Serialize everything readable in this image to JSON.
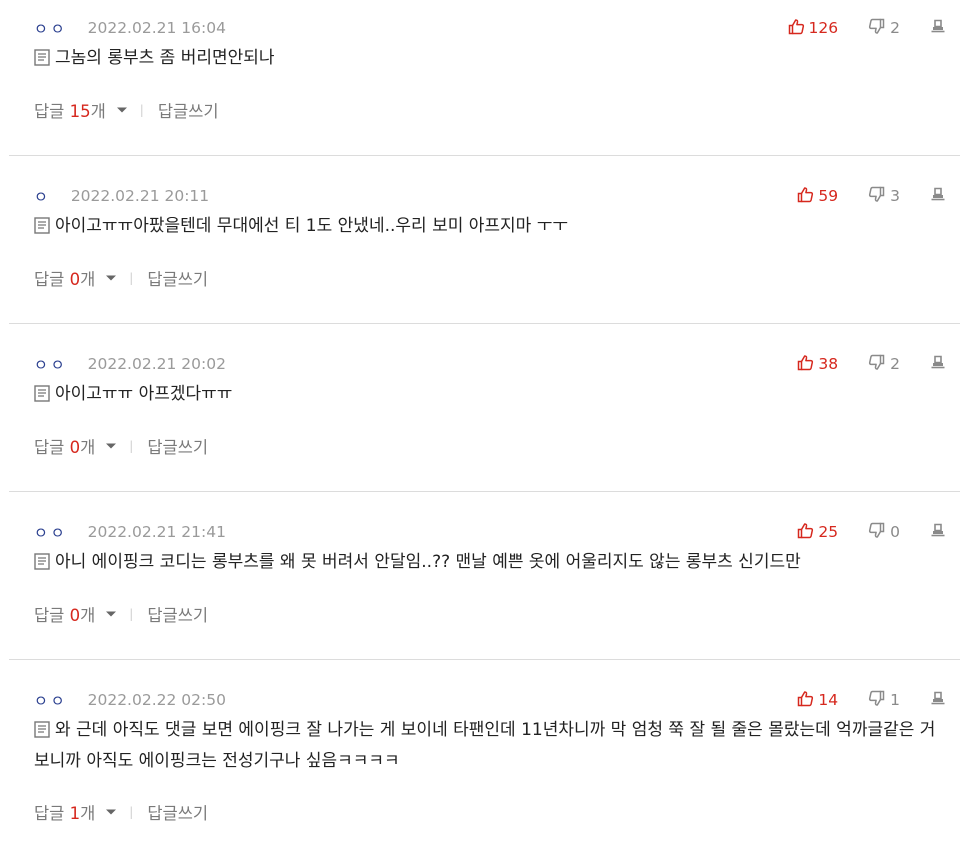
{
  "colors": {
    "accent_red": "#d6281e",
    "nick_blue": "#2a3f8f",
    "meta_gray": "#9a9a9a"
  },
  "icons": {
    "vote_up": "thumbs-up-icon",
    "vote_down": "thumbs-down-icon",
    "report": "report-icon",
    "memo": "memo-icon",
    "expand": "caret-down-icon"
  },
  "labels": {
    "reply_prefix": "답글 ",
    "reply_unit": "개",
    "write_reply": "답글쓰기",
    "separator": "|"
  },
  "comments": [
    {
      "nickname": "ㅇㅇ",
      "datetime": "2022.02.21 16:04",
      "up": "126",
      "down": "2",
      "text": "그놈의 롱부츠 좀 버리면안되나",
      "reply_count": "15"
    },
    {
      "nickname": "ㅇ",
      "datetime": "2022.02.21 20:11",
      "up": "59",
      "down": "3",
      "text": "아이고ㅠㅠ아팠을텐데 무대에선 티 1도 안냈네..우리 보미 아프지마 ㅜㅜ",
      "reply_count": "0"
    },
    {
      "nickname": "ㅇㅇ",
      "datetime": "2022.02.21 20:02",
      "up": "38",
      "down": "2",
      "text": "아이고ㅠㅠ 아프겠다ㅠㅠ",
      "reply_count": "0"
    },
    {
      "nickname": "ㅇㅇ",
      "datetime": "2022.02.21 21:41",
      "up": "25",
      "down": "0",
      "text": "아니 에이핑크 코디는 롱부츠를 왜 못 버려서 안달임..?? 맨날 예쁜 옷에 어울리지도 않는 롱부츠 신기드만",
      "reply_count": "0"
    },
    {
      "nickname": "ㅇㅇ",
      "datetime": "2022.02.22 02:50",
      "up": "14",
      "down": "1",
      "text": "와 근데 아직도 댓글 보면 에이핑크 잘 나가는 게 보이네 타팬인데 11년차니까 막 엄청 쭉 잘 될 줄은 몰랐는데 억까글같은 거 보니까 아직도 에이핑크는 전성기구나 싶음ㅋㅋㅋㅋ",
      "reply_count": "1"
    }
  ]
}
